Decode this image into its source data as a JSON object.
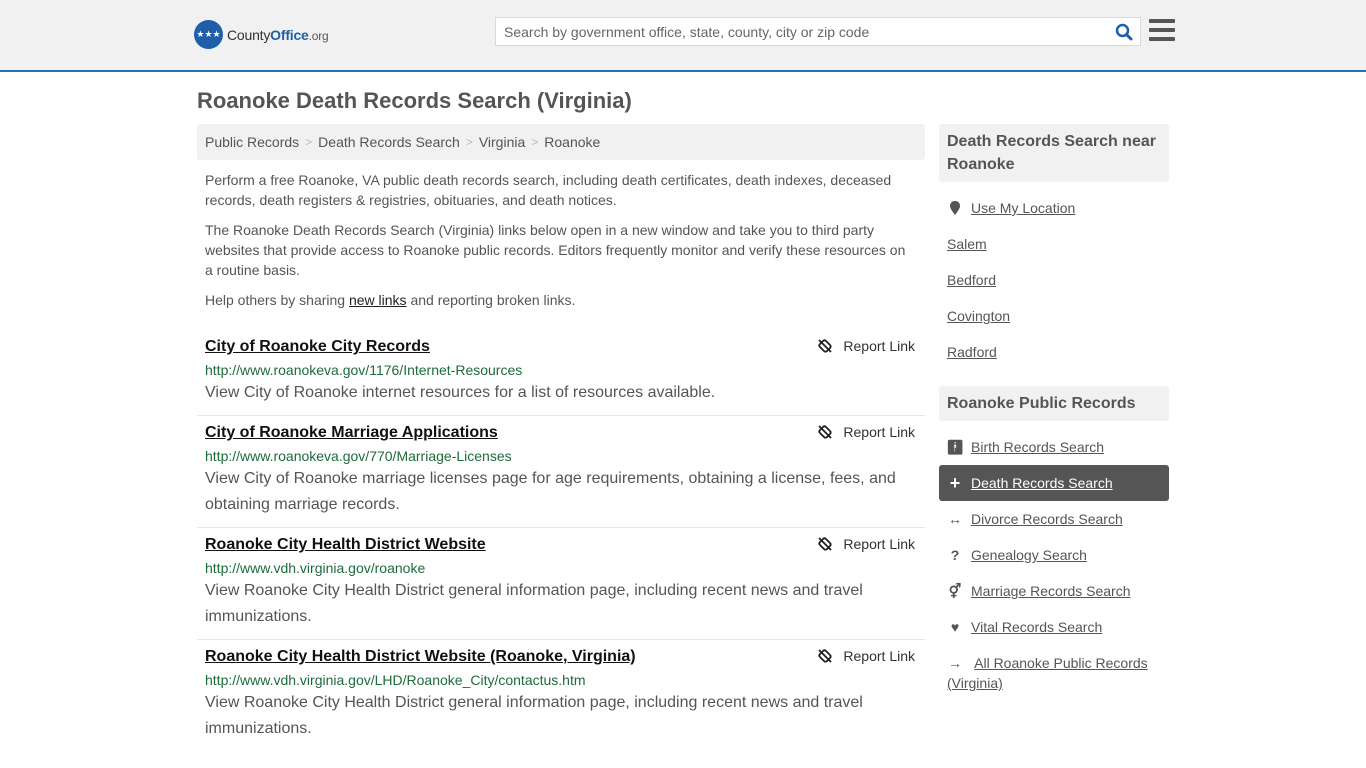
{
  "header": {
    "logo": {
      "name": "County",
      "accent": "Office",
      "tld": ".org"
    },
    "search_placeholder": "Search by government office, state, county, city or zip code",
    "search_value": ""
  },
  "page_title": "Roanoke Death Records Search (Virginia)",
  "breadcrumb": [
    "Public Records",
    "Death Records Search",
    "Virginia",
    "Roanoke"
  ],
  "intro": {
    "p1": "Perform a free Roanoke, VA public death records search, including death certificates, death indexes, deceased records, death registers & registries, obituaries, and death notices.",
    "p2": "The Roanoke Death Records Search (Virginia) links below open in a new window and take you to third party websites that provide access to Roanoke public records. Editors frequently monitor and verify these resources on a routine basis.",
    "p3_prefix": "Help others by sharing ",
    "p3_link": "new links",
    "p3_suffix": " and reporting broken links."
  },
  "report_label": "Report Link",
  "results": [
    {
      "title": "City of Roanoke City Records",
      "url": "http://www.roanokeva.gov/1176/Internet-Resources",
      "desc": "View City of Roanoke internet resources for a list of resources available."
    },
    {
      "title": "City of Roanoke Marriage Applications",
      "url": "http://www.roanokeva.gov/770/Marriage-Licenses",
      "desc": "View City of Roanoke marriage licenses page for age requirements, obtaining a license, fees, and obtaining marriage records."
    },
    {
      "title": "Roanoke City Health District Website",
      "url": "http://www.vdh.virginia.gov/roanoke",
      "desc": "View Roanoke City Health District general information page, including recent news and travel immunizations."
    },
    {
      "title": "Roanoke City Health District Website (Roanoke, Virginia)",
      "url": "http://www.vdh.virginia.gov/LHD/Roanoke_City/contactus.htm",
      "desc": "View Roanoke City Health District general information page, including recent news and travel immunizations."
    }
  ],
  "sidebar": {
    "nearby_title": "Death Records Search near Roanoke",
    "use_location": "Use My Location",
    "nearby": [
      "Salem",
      "Bedford",
      "Covington",
      "Radford"
    ],
    "public_title": "Roanoke Public Records",
    "public_links": [
      {
        "label": "Birth Records Search",
        "icon": "child-icon"
      },
      {
        "label": "Death Records Search",
        "icon": "plus-icon",
        "active": true
      },
      {
        "label": "Divorce Records Search",
        "icon": "arrows-horizontal-icon"
      },
      {
        "label": "Genealogy Search",
        "icon": "question-icon"
      },
      {
        "label": "Marriage Records Search",
        "icon": "gender-icon"
      },
      {
        "label": "Vital Records Search",
        "icon": "heartbeat-icon"
      },
      {
        "label": "All Roanoke Public Records (Virginia)",
        "icon": "arrow-right-icon"
      }
    ]
  },
  "colors": {
    "brand": "#1f5ea8",
    "url_green": "#1e6b3c",
    "active_bg": "#555555"
  }
}
